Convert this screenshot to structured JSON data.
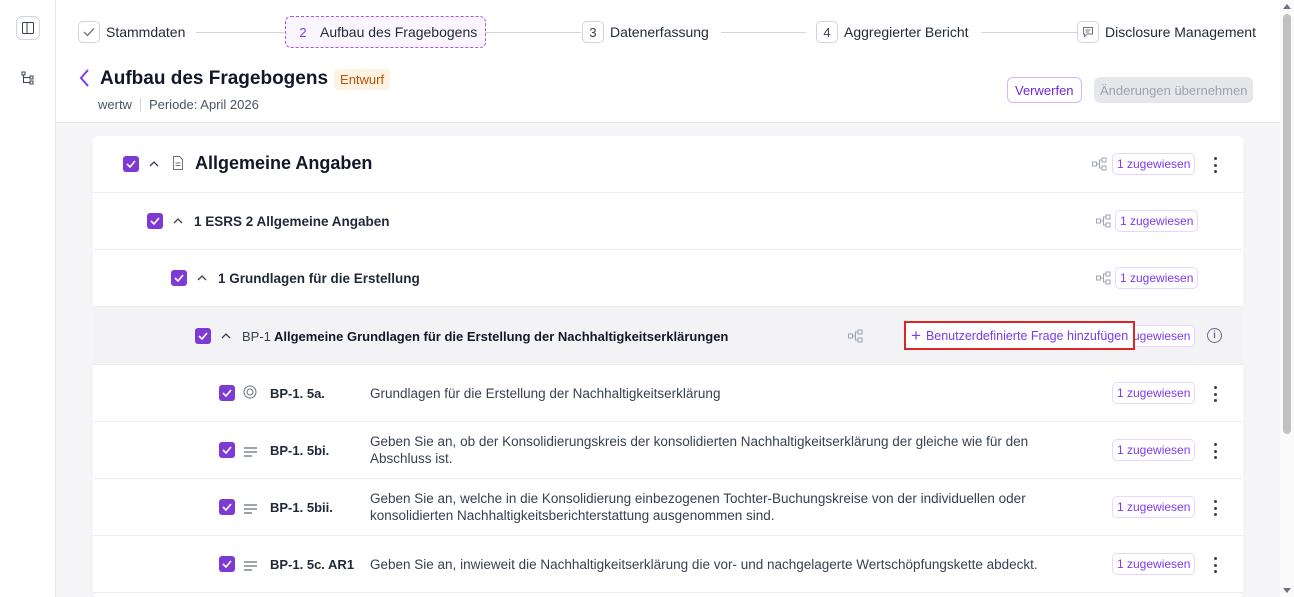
{
  "stepper": {
    "steps": [
      {
        "num": "✓",
        "label": "Stammdaten"
      },
      {
        "num": "2",
        "label": "Aufbau des Fragebogens"
      },
      {
        "num": "3",
        "label": "Datenerfassung"
      },
      {
        "num": "4",
        "label": "Aggregierter Bericht"
      },
      {
        "num": "",
        "label": "Disclosure Management"
      }
    ]
  },
  "header": {
    "title": "Aufbau des Fragebogens",
    "status": "Entwurf",
    "user": "wertw",
    "period": "Periode: April 2026",
    "discard_label": "Verwerfen",
    "apply_label": "Änderungen übernehmen"
  },
  "colors": {
    "accent": "#7e3bd4",
    "highlight": "#dc2626",
    "draft_bg": "#fef3e2"
  },
  "tree": {
    "section": {
      "title": "Allgemeine Angaben",
      "assigned": "1 zugewiesen"
    },
    "standard": {
      "title": "1 ESRS 2 Allgemeine Angaben",
      "assigned": "1 zugewiesen"
    },
    "chapter": {
      "title": "1 Grundlagen für die Erstellung",
      "assigned": "1 zugewiesen"
    },
    "disclosure": {
      "code": "BP-1",
      "title": "Allgemeine Grundlagen für die Erstellung der Nachhaltigkeitserklärungen",
      "add_custom_label": "Benutzerdefinierte Frage hinzufügen",
      "assigned": "1 zugewiesen"
    },
    "questions": [
      {
        "code": "BP-1. 5a.",
        "text": "Grundlagen für die Erstellung der Nachhaltigkeitserklärung",
        "assigned": "1 zugewiesen",
        "icon": "radio-icon"
      },
      {
        "code": "BP-1. 5bi.",
        "text": "Geben Sie an, ob der Konsolidierungskreis der konsolidierten Nachhaltigkeitserklärung der gleiche wie für den Abschluss ist.",
        "assigned": "1 zugewiesen",
        "icon": "text-icon"
      },
      {
        "code": "BP-1. 5bii.",
        "text": "Geben Sie an, welche in die Konsolidierung einbezogenen Tochter-Buchungskreise von der individuellen oder konsolidierten Nachhaltigkeitsberichterstattung ausgenommen sind.",
        "assigned": "1 zugewiesen",
        "icon": "text-icon"
      },
      {
        "code": "BP-1. 5c. AR1",
        "text": "Geben Sie an, inwieweit die Nachhaltigkeitserklärung die vor- und nachgelagerte Wertschöpfungskette abdeckt.",
        "assigned": "1 zugewiesen",
        "icon": "text-icon"
      }
    ]
  }
}
